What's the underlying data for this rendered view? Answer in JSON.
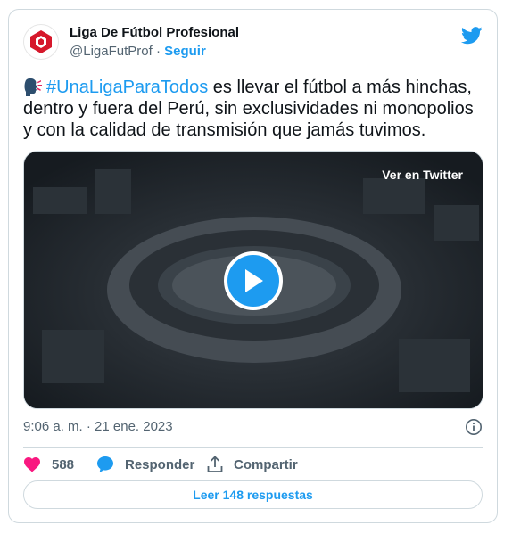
{
  "account": {
    "name": "Liga De Fútbol Profesional",
    "handle": "@LigaFutProf",
    "separator": " · ",
    "follow_label": "Seguir"
  },
  "tweet": {
    "hashtag": "#UnaLigaParaTodos",
    "body": " es llevar el fútbol a más hinchas, dentro y fuera del Perú, sin exclusividades ni monopolios y con la calidad de transmisión que jamás tuvimos."
  },
  "media": {
    "view_label": "Ver en Twitter"
  },
  "meta": {
    "timestamp": "9:06 a. m. · 21 ene. 2023"
  },
  "actions": {
    "likes": "588",
    "reply_label": "Responder",
    "share_label": "Compartir"
  },
  "footer": {
    "read_label": "Leer 148 respuestas"
  },
  "colors": {
    "accent": "#1d9bf0",
    "like": "#f91880",
    "brand_red": "#d6182b"
  }
}
